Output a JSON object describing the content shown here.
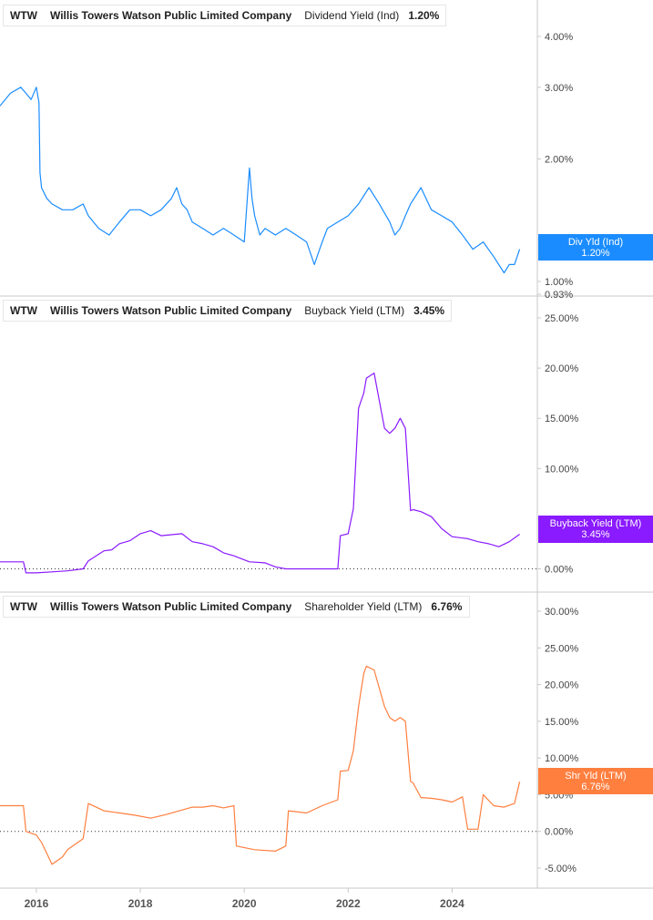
{
  "panels": [
    {
      "ticker": "WTW",
      "company": "Willis Towers Watson Public Limited Company",
      "metric": "Dividend Yield (Ind)",
      "value": "1.20%",
      "color": "#1a8cff",
      "callout_title": "Div Yld (Ind)",
      "callout_value": "1.20%"
    },
    {
      "ticker": "WTW",
      "company": "Willis Towers Watson Public Limited Company",
      "metric": "Buyback Yield (LTM)",
      "value": "3.45%",
      "color": "#8a1aff",
      "callout_title": "Buyback Yield (LTM)",
      "callout_value": "3.45%"
    },
    {
      "ticker": "WTW",
      "company": "Willis Towers Watson Public Limited Company",
      "metric": "Shareholder Yield (LTM)",
      "value": "6.76%",
      "color": "#ff7f3f",
      "callout_title": "Shr Yld (LTM)",
      "callout_value": "6.76%"
    }
  ],
  "chart_data": [
    {
      "type": "line",
      "title": "",
      "series": [
        {
          "name": "Dividend Yield (Ind)",
          "color": "#1a8cff",
          "x": [
            2015.3,
            2015.5,
            2015.7,
            2015.8,
            2015.9,
            2016.0,
            2016.05,
            2016.07,
            2016.1,
            2016.2,
            2016.3,
            2016.5,
            2016.7,
            2016.9,
            2017.0,
            2017.2,
            2017.4,
            2017.6,
            2017.8,
            2018.0,
            2018.2,
            2018.4,
            2018.6,
            2018.7,
            2018.8,
            2018.9,
            2019.0,
            2019.2,
            2019.4,
            2019.6,
            2019.8,
            2020.0,
            2020.1,
            2020.15,
            2020.2,
            2020.3,
            2020.4,
            2020.6,
            2020.8,
            2021.0,
            2021.2,
            2021.35,
            2021.4,
            2021.5,
            2021.6,
            2021.8,
            2022.0,
            2022.2,
            2022.4,
            2022.6,
            2022.8,
            2022.9,
            2023.0,
            2023.1,
            2023.2,
            2023.4,
            2023.6,
            2023.8,
            2024.0,
            2024.2,
            2024.4,
            2024.6,
            2024.8,
            2025.0,
            2025.1,
            2025.2,
            2025.3
          ],
          "y": [
            2.7,
            2.9,
            3.0,
            2.9,
            2.8,
            3.0,
            2.75,
            1.85,
            1.7,
            1.6,
            1.55,
            1.5,
            1.5,
            1.55,
            1.45,
            1.35,
            1.3,
            1.4,
            1.5,
            1.5,
            1.45,
            1.5,
            1.6,
            1.7,
            1.55,
            1.5,
            1.4,
            1.35,
            1.3,
            1.35,
            1.3,
            1.25,
            1.9,
            1.6,
            1.45,
            1.3,
            1.35,
            1.3,
            1.35,
            1.3,
            1.25,
            1.1,
            1.15,
            1.25,
            1.35,
            1.4,
            1.45,
            1.55,
            1.7,
            1.55,
            1.4,
            1.3,
            1.35,
            1.45,
            1.55,
            1.7,
            1.5,
            1.45,
            1.4,
            1.3,
            1.2,
            1.25,
            1.15,
            1.05,
            1.1,
            1.1,
            1.2
          ]
        }
      ],
      "ylim": [
        0.93,
        4.3
      ],
      "yscale": "log",
      "ytick_labels": [
        "4.00%",
        "3.00%",
        "2.00%",
        "1.00%",
        "0.93%"
      ],
      "ytick_values": [
        4.0,
        3.0,
        2.0,
        1.0,
        0.93
      ]
    },
    {
      "type": "line",
      "title": "",
      "series": [
        {
          "name": "Buyback Yield (LTM)",
          "color": "#8a1aff",
          "x": [
            2015.3,
            2015.75,
            2015.8,
            2016.0,
            2016.3,
            2016.6,
            2016.9,
            2017.0,
            2017.3,
            2017.45,
            2017.6,
            2017.8,
            2018.0,
            2018.2,
            2018.4,
            2018.6,
            2018.8,
            2019.0,
            2019.2,
            2019.4,
            2019.6,
            2019.8,
            2020.1,
            2020.4,
            2020.6,
            2020.8,
            2021.0,
            2021.5,
            2021.8,
            2021.85,
            2022.0,
            2022.1,
            2022.2,
            2022.3,
            2022.35,
            2022.5,
            2022.7,
            2022.8,
            2022.9,
            2023.0,
            2023.1,
            2023.2,
            2023.25,
            2023.4,
            2023.6,
            2023.8,
            2024.0,
            2024.3,
            2024.5,
            2024.7,
            2024.9,
            2025.1,
            2025.3
          ],
          "y": [
            0.7,
            0.7,
            -0.4,
            -0.4,
            -0.3,
            -0.2,
            0.0,
            0.8,
            1.8,
            1.9,
            2.5,
            2.8,
            3.5,
            3.8,
            3.3,
            3.4,
            3.5,
            2.7,
            2.5,
            2.2,
            1.6,
            1.3,
            0.7,
            0.6,
            0.2,
            0.0,
            0.0,
            0.0,
            0.0,
            3.3,
            3.5,
            6.0,
            16.0,
            17.5,
            19.0,
            19.5,
            14.0,
            13.5,
            14.0,
            15.0,
            14.0,
            5.8,
            5.9,
            5.7,
            5.2,
            4.0,
            3.2,
            3.0,
            2.7,
            2.5,
            2.2,
            2.7,
            3.45
          ]
        }
      ],
      "ylim": [
        -0.5,
        25.0
      ],
      "ytick_labels": [
        "25.00%",
        "20.00%",
        "15.00%",
        "10.00%",
        "5.00%",
        "0.00%"
      ],
      "ytick_values": [
        25,
        20,
        15,
        10,
        5,
        0
      ]
    },
    {
      "type": "line",
      "title": "",
      "series": [
        {
          "name": "Shareholder Yield (LTM)",
          "color": "#ff7f3f",
          "x": [
            2015.3,
            2015.75,
            2015.8,
            2016.0,
            2016.1,
            2016.3,
            2016.5,
            2016.6,
            2016.9,
            2017.0,
            2017.3,
            2017.6,
            2017.9,
            2018.2,
            2018.5,
            2018.8,
            2019.0,
            2019.2,
            2019.4,
            2019.6,
            2019.8,
            2019.85,
            2020.2,
            2020.6,
            2020.8,
            2020.85,
            2021.2,
            2021.5,
            2021.8,
            2021.85,
            2022.0,
            2022.1,
            2022.2,
            2022.3,
            2022.35,
            2022.5,
            2022.7,
            2022.8,
            2022.9,
            2023.0,
            2023.1,
            2023.2,
            2023.25,
            2023.4,
            2023.6,
            2023.8,
            2024.0,
            2024.2,
            2024.3,
            2024.5,
            2024.6,
            2024.8,
            2025.0,
            2025.2,
            2025.3
          ],
          "y": [
            3.5,
            3.5,
            0.0,
            -0.5,
            -1.5,
            -4.5,
            -3.5,
            -2.5,
            -1.0,
            3.8,
            2.8,
            2.5,
            2.2,
            1.8,
            2.3,
            2.9,
            3.3,
            3.3,
            3.5,
            3.2,
            3.5,
            -2.0,
            -2.5,
            -2.7,
            -2.0,
            2.8,
            2.5,
            3.5,
            4.3,
            8.2,
            8.3,
            11.0,
            17.0,
            21.5,
            22.5,
            22.0,
            17.0,
            15.5,
            15.0,
            15.5,
            15.0,
            6.8,
            6.6,
            4.6,
            4.5,
            4.3,
            4.0,
            4.7,
            0.3,
            0.3,
            5.0,
            3.5,
            3.3,
            3.8,
            6.76
          ]
        }
      ],
      "ylim": [
        -5.5,
        30.0
      ],
      "ytick_labels": [
        "30.00%",
        "25.00%",
        "20.00%",
        "15.00%",
        "10.00%",
        "5.00%",
        "0.00%",
        "-5.00%"
      ],
      "ytick_values": [
        30,
        25,
        20,
        15,
        10,
        5,
        0,
        -5
      ]
    }
  ],
  "x_axis": {
    "labels": [
      "2016",
      "2018",
      "2020",
      "2022",
      "2024"
    ],
    "values": [
      2016,
      2018,
      2020,
      2022,
      2024
    ],
    "range": [
      2015.3,
      2025.5
    ]
  },
  "colors": {
    "grid": "#c8c8c8",
    "axis_text": "#444444",
    "zero_line": "#333333"
  }
}
